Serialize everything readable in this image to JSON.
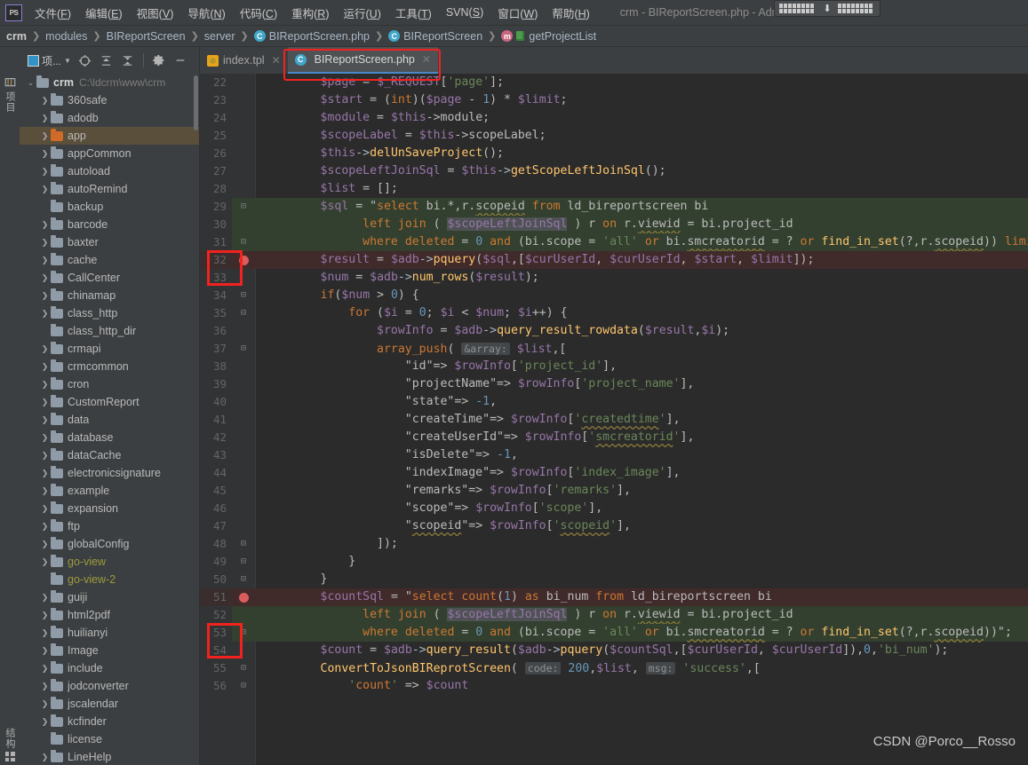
{
  "window": {
    "title": "crm - BIReportScreen.php - Administrator",
    "logo": "PS"
  },
  "menubar": {
    "items": [
      {
        "label": "文件(F)"
      },
      {
        "label": "编辑(E)"
      },
      {
        "label": "视图(V)"
      },
      {
        "label": "导航(N)"
      },
      {
        "label": "代码(C)"
      },
      {
        "label": "重构(R)"
      },
      {
        "label": "运行(U)"
      },
      {
        "label": "工具(T)"
      },
      {
        "label": "SVN(S)"
      },
      {
        "label": "窗口(W)"
      },
      {
        "label": "帮助(H)"
      }
    ]
  },
  "breadcrumb": {
    "items": [
      {
        "label": "crm",
        "icon": "none",
        "root": true
      },
      {
        "label": "modules",
        "icon": "none"
      },
      {
        "label": "BIReportScreen",
        "icon": "none"
      },
      {
        "label": "server",
        "icon": "none"
      },
      {
        "label": "BIReportScreen.php",
        "icon": "class-icon"
      },
      {
        "label": "BIReportScreen",
        "icon": "class-icon"
      },
      {
        "label": "getProjectList",
        "icon": "method-icon"
      }
    ]
  },
  "toolbar": {
    "project_label": "项...",
    "buttons": [
      {
        "name": "locate-icon",
        "glyph": "⊕"
      },
      {
        "name": "expand-all-icon",
        "glyph": "⇟"
      },
      {
        "name": "collapse-all-icon",
        "glyph": "⇡"
      },
      {
        "name": "settings-gear-icon",
        "glyph": "⚙"
      },
      {
        "name": "hide-panel-icon",
        "glyph": "—"
      }
    ]
  },
  "tabs": [
    {
      "label": "index.tpl",
      "icon": "template-icon",
      "active": false
    },
    {
      "label": "BIReportScreen.php",
      "icon": "class-icon",
      "active": true
    }
  ],
  "left_rail": {
    "top_label": "项目",
    "bottom_label": "结构"
  },
  "tree": {
    "items": [
      {
        "label": "crm",
        "path": "C:\\ldcrm\\www\\crm",
        "indent": 0,
        "expanded": true,
        "bold": true,
        "arrow": "down"
      },
      {
        "label": "360safe",
        "indent": 1,
        "arrow": "right"
      },
      {
        "label": "adodb",
        "indent": 1,
        "arrow": "right"
      },
      {
        "label": "app",
        "indent": 1,
        "arrow": "right",
        "selected": true,
        "folder_color": "orange"
      },
      {
        "label": "appCommon",
        "indent": 1,
        "arrow": "right"
      },
      {
        "label": "autoload",
        "indent": 1,
        "arrow": "right"
      },
      {
        "label": "autoRemind",
        "indent": 1,
        "arrow": "right"
      },
      {
        "label": "backup",
        "indent": 1,
        "arrow": "none"
      },
      {
        "label": "barcode",
        "indent": 1,
        "arrow": "right"
      },
      {
        "label": "baxter",
        "indent": 1,
        "arrow": "right"
      },
      {
        "label": "cache",
        "indent": 1,
        "arrow": "right"
      },
      {
        "label": "CallCenter",
        "indent": 1,
        "arrow": "right"
      },
      {
        "label": "chinamap",
        "indent": 1,
        "arrow": "right"
      },
      {
        "label": "class_http",
        "indent": 1,
        "arrow": "right"
      },
      {
        "label": "class_http_dir",
        "indent": 1,
        "arrow": "none"
      },
      {
        "label": "crmapi",
        "indent": 1,
        "arrow": "right"
      },
      {
        "label": "crmcommon",
        "indent": 1,
        "arrow": "right"
      },
      {
        "label": "cron",
        "indent": 1,
        "arrow": "right"
      },
      {
        "label": "CustomReport",
        "indent": 1,
        "arrow": "right"
      },
      {
        "label": "data",
        "indent": 1,
        "arrow": "right"
      },
      {
        "label": "database",
        "indent": 1,
        "arrow": "right"
      },
      {
        "label": "dataCache",
        "indent": 1,
        "arrow": "right"
      },
      {
        "label": "electronicsignature",
        "indent": 1,
        "arrow": "right"
      },
      {
        "label": "example",
        "indent": 1,
        "arrow": "right"
      },
      {
        "label": "expansion",
        "indent": 1,
        "arrow": "right"
      },
      {
        "label": "ftp",
        "indent": 1,
        "arrow": "right"
      },
      {
        "label": "globalConfig",
        "indent": 1,
        "arrow": "right"
      },
      {
        "label": "go-view",
        "indent": 1,
        "arrow": "right",
        "text_color": "olive"
      },
      {
        "label": "go-view-2",
        "indent": 1,
        "arrow": "none",
        "text_color": "olive"
      },
      {
        "label": "guiji",
        "indent": 1,
        "arrow": "right"
      },
      {
        "label": "html2pdf",
        "indent": 1,
        "arrow": "right"
      },
      {
        "label": "huilianyi",
        "indent": 1,
        "arrow": "right"
      },
      {
        "label": "Image",
        "indent": 1,
        "arrow": "right"
      },
      {
        "label": "include",
        "indent": 1,
        "arrow": "right"
      },
      {
        "label": "jodconverter",
        "indent": 1,
        "arrow": "right"
      },
      {
        "label": "jscalendar",
        "indent": 1,
        "arrow": "right"
      },
      {
        "label": "kcfinder",
        "indent": 1,
        "arrow": "right"
      },
      {
        "label": "license",
        "indent": 1,
        "arrow": "none"
      },
      {
        "label": "LineHelp",
        "indent": 1,
        "arrow": "right"
      }
    ]
  },
  "editor": {
    "first_line": 22,
    "watermark": "CSDN @Porco__Rosso",
    "inlay_hints": [
      "&array:",
      "code:",
      "msg:"
    ],
    "breakpoint_lines": [
      32,
      51
    ],
    "highlighted_lines_green": [
      29,
      30,
      31,
      52,
      53
    ],
    "highlighted_lines_red": [
      32,
      51
    ],
    "lines": [
      {
        "n": 22,
        "text": "        $page = $_REQUEST['page'];"
      },
      {
        "n": 23,
        "text": "        $start = (int)($page - 1) * $limit;"
      },
      {
        "n": 24,
        "text": "        $module = $this->module;"
      },
      {
        "n": 25,
        "text": "        $scopeLabel = $this->scopeLabel;"
      },
      {
        "n": 26,
        "text": "        $this->delUnSaveProject();"
      },
      {
        "n": 27,
        "text": "        $scopeLeftJoinSql = $this->getScopeLeftJoinSql();"
      },
      {
        "n": 28,
        "text": "        $list = [];"
      },
      {
        "n": 29,
        "text": "        $sql = \"select bi.*,r.scopeid from ld_bireportscreen bi"
      },
      {
        "n": 30,
        "text": "              left join ( $scopeLeftJoinSql ) r on r.viewid = bi.project_id"
      },
      {
        "n": 31,
        "text": "              where deleted = 0 and (bi.scope = 'all' or bi.smcreatorid = ? or find_in_set(?,r.scopeid)) limit"
      },
      {
        "n": 32,
        "text": "        $result = $adb->pquery($sql,[$curUserId, $curUserId, $start, $limit]);"
      },
      {
        "n": 33,
        "text": "        $num = $adb->num_rows($result);"
      },
      {
        "n": 34,
        "text": "        if($num > 0) {"
      },
      {
        "n": 35,
        "text": "            for ($i = 0; $i < $num; $i++) {"
      },
      {
        "n": 36,
        "text": "                $rowInfo = $adb->query_result_rowdata($result,$i);"
      },
      {
        "n": 37,
        "text": "                array_push( &array: $list,["
      },
      {
        "n": 38,
        "text": "                    \"id\"=> $rowInfo['project_id'],"
      },
      {
        "n": 39,
        "text": "                    \"projectName\"=> $rowInfo['project_name'],"
      },
      {
        "n": 40,
        "text": "                    \"state\"=> -1,"
      },
      {
        "n": 41,
        "text": "                    \"createTime\"=> $rowInfo['createdtime'],"
      },
      {
        "n": 42,
        "text": "                    \"createUserId\"=> $rowInfo['smcreatorid'],"
      },
      {
        "n": 43,
        "text": "                    \"isDelete\"=> -1,"
      },
      {
        "n": 44,
        "text": "                    \"indexImage\"=> $rowInfo['index_image'],"
      },
      {
        "n": 45,
        "text": "                    \"remarks\"=> $rowInfo['remarks'],"
      },
      {
        "n": 46,
        "text": "                    \"scope\"=> $rowInfo['scope'],"
      },
      {
        "n": 47,
        "text": "                    \"scopeid\"=> $rowInfo['scopeid'],"
      },
      {
        "n": 48,
        "text": "                ]);"
      },
      {
        "n": 49,
        "text": "            }"
      },
      {
        "n": 50,
        "text": "        }"
      },
      {
        "n": 51,
        "text": "        $countSql = \"select count(1) as bi_num from ld_bireportscreen bi"
      },
      {
        "n": 52,
        "text": "              left join ( $scopeLeftJoinSql ) r on r.viewid = bi.project_id"
      },
      {
        "n": 53,
        "text": "              where deleted = 0 and (bi.scope = 'all' or bi.smcreatorid = ? or find_in_set(?,r.scopeid))\";"
      },
      {
        "n": 54,
        "text": "        $count = $adb->query_result($adb->pquery($countSql,[$curUserId, $curUserId]),0,'bi_num');"
      },
      {
        "n": 55,
        "text": "        ConvertToJsonBIReprotScreen( code: 200,$list, msg: 'success',["
      },
      {
        "n": 56,
        "text": "            'count' => $count"
      }
    ]
  },
  "colors": {
    "accent": "#4a88c7",
    "breakpoint": "#db5c5c",
    "annotation": "#f2221f",
    "selection": "#5a4f3a",
    "editor_bg": "#2b2b2b",
    "chrome_bg": "#3c3f41"
  }
}
